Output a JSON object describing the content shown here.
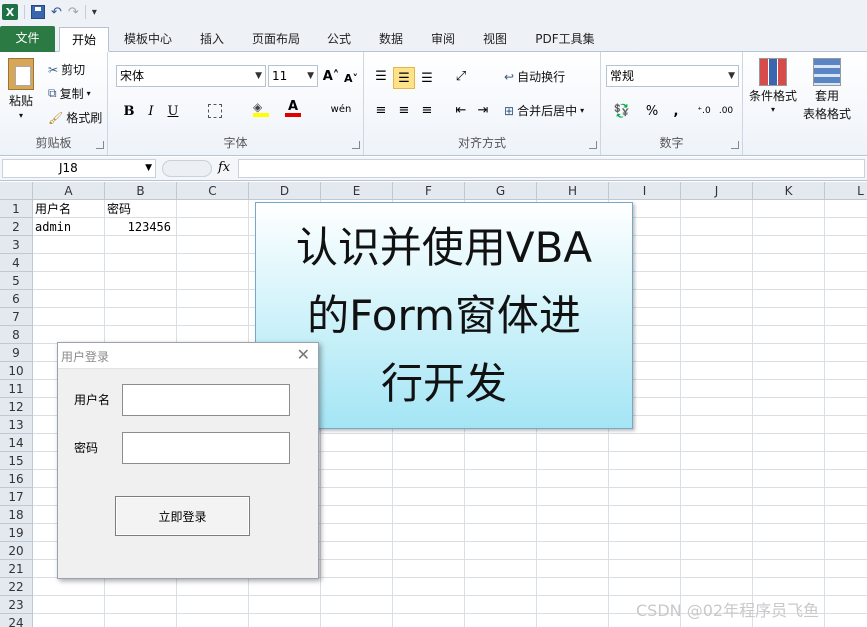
{
  "qat": {
    "undo": "↶",
    "redo": "↷",
    "customize": "▾"
  },
  "tabs": [
    {
      "label": "文件"
    },
    {
      "label": "开始"
    },
    {
      "label": "模板中心"
    },
    {
      "label": "插入"
    },
    {
      "label": "页面布局"
    },
    {
      "label": "公式"
    },
    {
      "label": "数据"
    },
    {
      "label": "审阅"
    },
    {
      "label": "视图"
    },
    {
      "label": "PDF工具集"
    }
  ],
  "ribbon": {
    "clipboard": {
      "paste": "粘贴",
      "cut": "剪切",
      "copy": "复制",
      "format_painter": "格式刷",
      "label": "剪贴板"
    },
    "font": {
      "name": "宋体",
      "size": "11",
      "bold": "B",
      "italic": "I",
      "underline": "U",
      "grow": "A˄",
      "shrink": "A˅",
      "phonetic": "wén",
      "label": "字体"
    },
    "alignment": {
      "wrap": "自动换行",
      "merge": "合并后居中",
      "label": "对齐方式"
    },
    "number": {
      "format": "常规",
      "percent": "%",
      "comma": ",",
      "label": "数字"
    },
    "styles": {
      "conditional": "条件格式",
      "table_line1": "套用",
      "table_line2": "表格格式"
    }
  },
  "formula_bar": {
    "name_box": "J18",
    "fx": "fx",
    "content": ""
  },
  "grid": {
    "columns": [
      "A",
      "B",
      "C",
      "D",
      "E",
      "F",
      "G",
      "H",
      "I",
      "J",
      "K",
      "L"
    ],
    "rows": [
      "1",
      "2",
      "3",
      "4",
      "5",
      "6",
      "7",
      "8",
      "9",
      "10",
      "11",
      "12",
      "13",
      "14",
      "15",
      "16",
      "17",
      "18",
      "19",
      "20",
      "21",
      "22",
      "23",
      "24"
    ],
    "cells": {
      "A1": "用户名",
      "B1": "密码",
      "A2": "admin",
      "B2": "123456"
    }
  },
  "banner": {
    "line1": "认识并使用VBA",
    "line2": "的Form窗体进",
    "line3": "行开发"
  },
  "login_form": {
    "title": "用户登录",
    "close": "✕",
    "username_label": "用户名",
    "password_label": "密码",
    "username_value": "",
    "password_value": "",
    "submit_label": "立即登录"
  },
  "watermark": "CSDN @02年程序员飞鱼",
  "colors": {
    "file_tab": "#2c7a43",
    "banner_top": "#ffffff",
    "banner_bottom": "#a4e5f5",
    "highlight": "#fde28a"
  }
}
